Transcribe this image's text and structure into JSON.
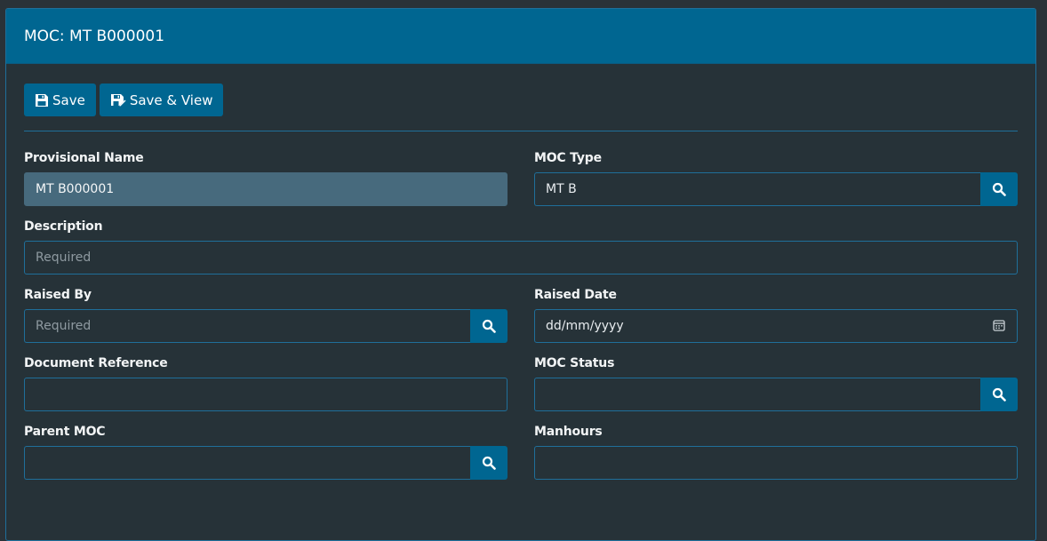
{
  "header": {
    "title": "MOC: MT B000001"
  },
  "toolbar": {
    "save_label": "Save",
    "save_view_label": "Save & View"
  },
  "fields": {
    "provisional_name": {
      "label": "Provisional Name",
      "value": "MT B000001"
    },
    "moc_type": {
      "label": "MOC Type",
      "value": "MT B"
    },
    "description": {
      "label": "Description",
      "placeholder": "Required"
    },
    "raised_by": {
      "label": "Raised By",
      "placeholder": "Required"
    },
    "raised_date": {
      "label": "Raised Date",
      "value": "dd/mm/yyyy"
    },
    "document_reference": {
      "label": "Document Reference",
      "value": ""
    },
    "moc_status": {
      "label": "MOC Status",
      "value": ""
    },
    "parent_moc": {
      "label": "Parent MOC",
      "value": ""
    },
    "manhours": {
      "label": "Manhours",
      "value": ""
    }
  },
  "icons": {
    "save": "floppy-disk-icon",
    "save_view": "floppy-disk-pen-icon",
    "search": "magnifier-icon",
    "calendar": "calendar-icon"
  },
  "colors": {
    "accent": "#006691",
    "background": "#263238",
    "border": "#1f6f9a",
    "readonly_fill": "#476a7d"
  }
}
